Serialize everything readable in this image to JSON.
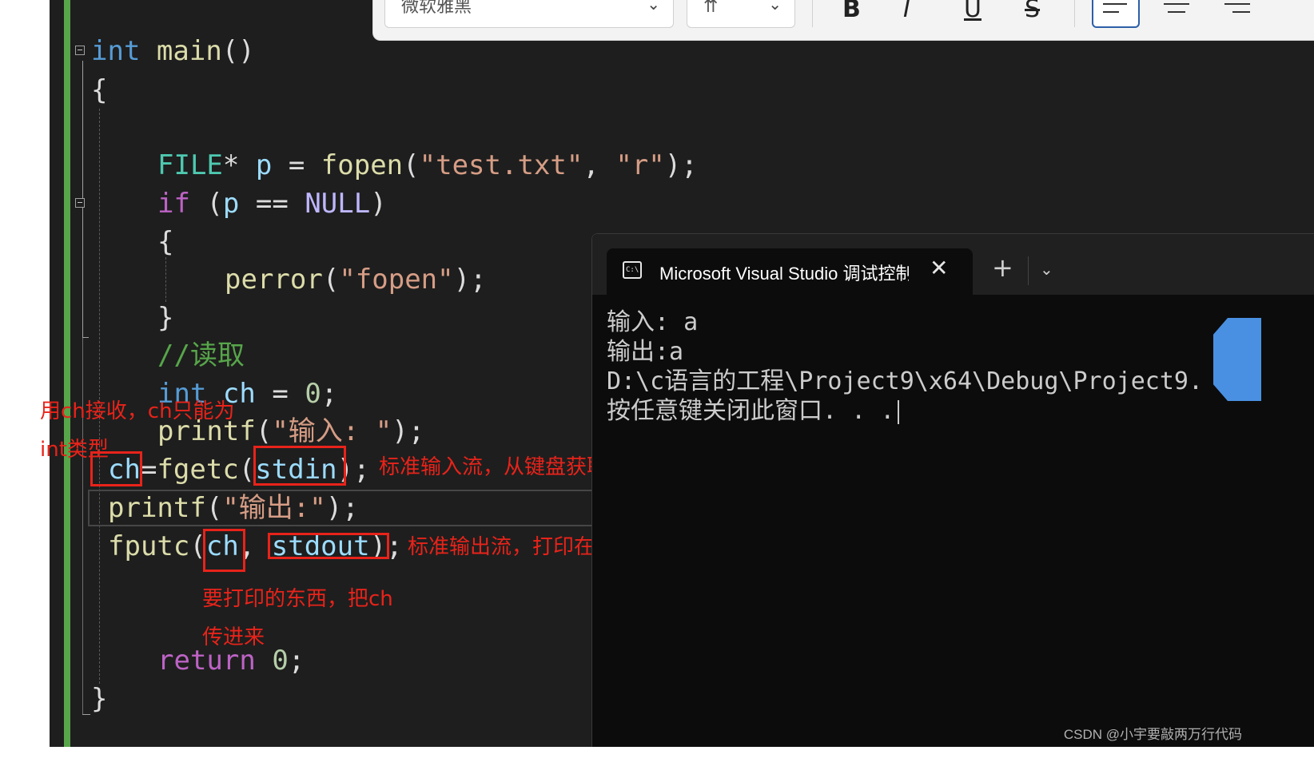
{
  "toolbar": {
    "font_name": "微软雅黑",
    "font_size_glyph": "⇈",
    "chevron": "⌄",
    "bold_label": "B",
    "italic_label": "I",
    "underline_label": "U",
    "strike_label": "S"
  },
  "code": {
    "lines": [
      {
        "id": "l1",
        "text": "int main()"
      },
      {
        "id": "l2",
        "text": "{"
      },
      {
        "id": "l3",
        "text": "FILE* p = fopen(\"test.txt\", \"r\");"
      },
      {
        "id": "l4",
        "text": "if (p == NULL)"
      },
      {
        "id": "l5",
        "text": "{"
      },
      {
        "id": "l6",
        "text": "perror(\"fopen\");"
      },
      {
        "id": "l7",
        "text": "}"
      },
      {
        "id": "l8",
        "text": "//读取"
      },
      {
        "id": "l9",
        "text": "int ch = 0;"
      },
      {
        "id": "l10",
        "text": "printf(\"输入: \");"
      },
      {
        "id": "l11",
        "text": "ch=fgetc(stdin);"
      },
      {
        "id": "l12",
        "text": "printf(\"输出:\");"
      },
      {
        "id": "l13",
        "text": "fputc(ch, stdout);"
      },
      {
        "id": "l14",
        "text": "return 0;"
      },
      {
        "id": "l15",
        "text": "}"
      }
    ],
    "tokens": {
      "int": "int",
      "main": "main",
      "parens": "()",
      "brace_open": "{",
      "brace_close": "}",
      "FILE": "FILE",
      "star": "*",
      "p": "p",
      "eq": "=",
      "fopen": "fopen",
      "lp": "(",
      "rp": ")",
      "test_txt": "\"test.txt\"",
      "comma": ",",
      "r_str": "\"r\"",
      "semi": ";",
      "if": "if",
      "eqeq": "==",
      "NULL": "NULL",
      "perror": "perror",
      "fopen_str": "\"fopen\"",
      "comment": "//读取",
      "ch": "ch",
      "zero": "0",
      "printf": "printf",
      "input_str": "\"输入: \"",
      "fgetc": "fgetc",
      "stdin": "stdin",
      "output_str": "\"输出:\"",
      "fputc": "fputc",
      "stdout": "stdout",
      "return": "return"
    }
  },
  "annotations": {
    "ch_int_line1": "用ch接收，ch只能为",
    "ch_int_line2": "int类型",
    "stdin_note": "标准输入流，从键盘获取",
    "stdout_note": "标准输出流，打印在屏幕上",
    "print_note_line1": "要打印的东西，把ch",
    "print_note_line2": "传进来"
  },
  "terminal": {
    "tab_title": "Microsoft Visual Studio 调试控制台",
    "close_glyph": "✕",
    "new_tab_glyph": "+",
    "dropdown_glyph": "⌄",
    "output_lines": [
      "输入: a",
      "输出:a",
      "D:\\c语言的工程\\Project9\\x64\\Debug\\Project9.",
      "按任意键关闭此窗口. . ."
    ]
  },
  "watermark": "CSDN @小宇要敲两万行代码",
  "colors": {
    "annotation": "#e8231a",
    "editor_bg": "#1e1e1e",
    "terminal_bg": "#0c0c0c",
    "change_bar": "#57a64a"
  }
}
